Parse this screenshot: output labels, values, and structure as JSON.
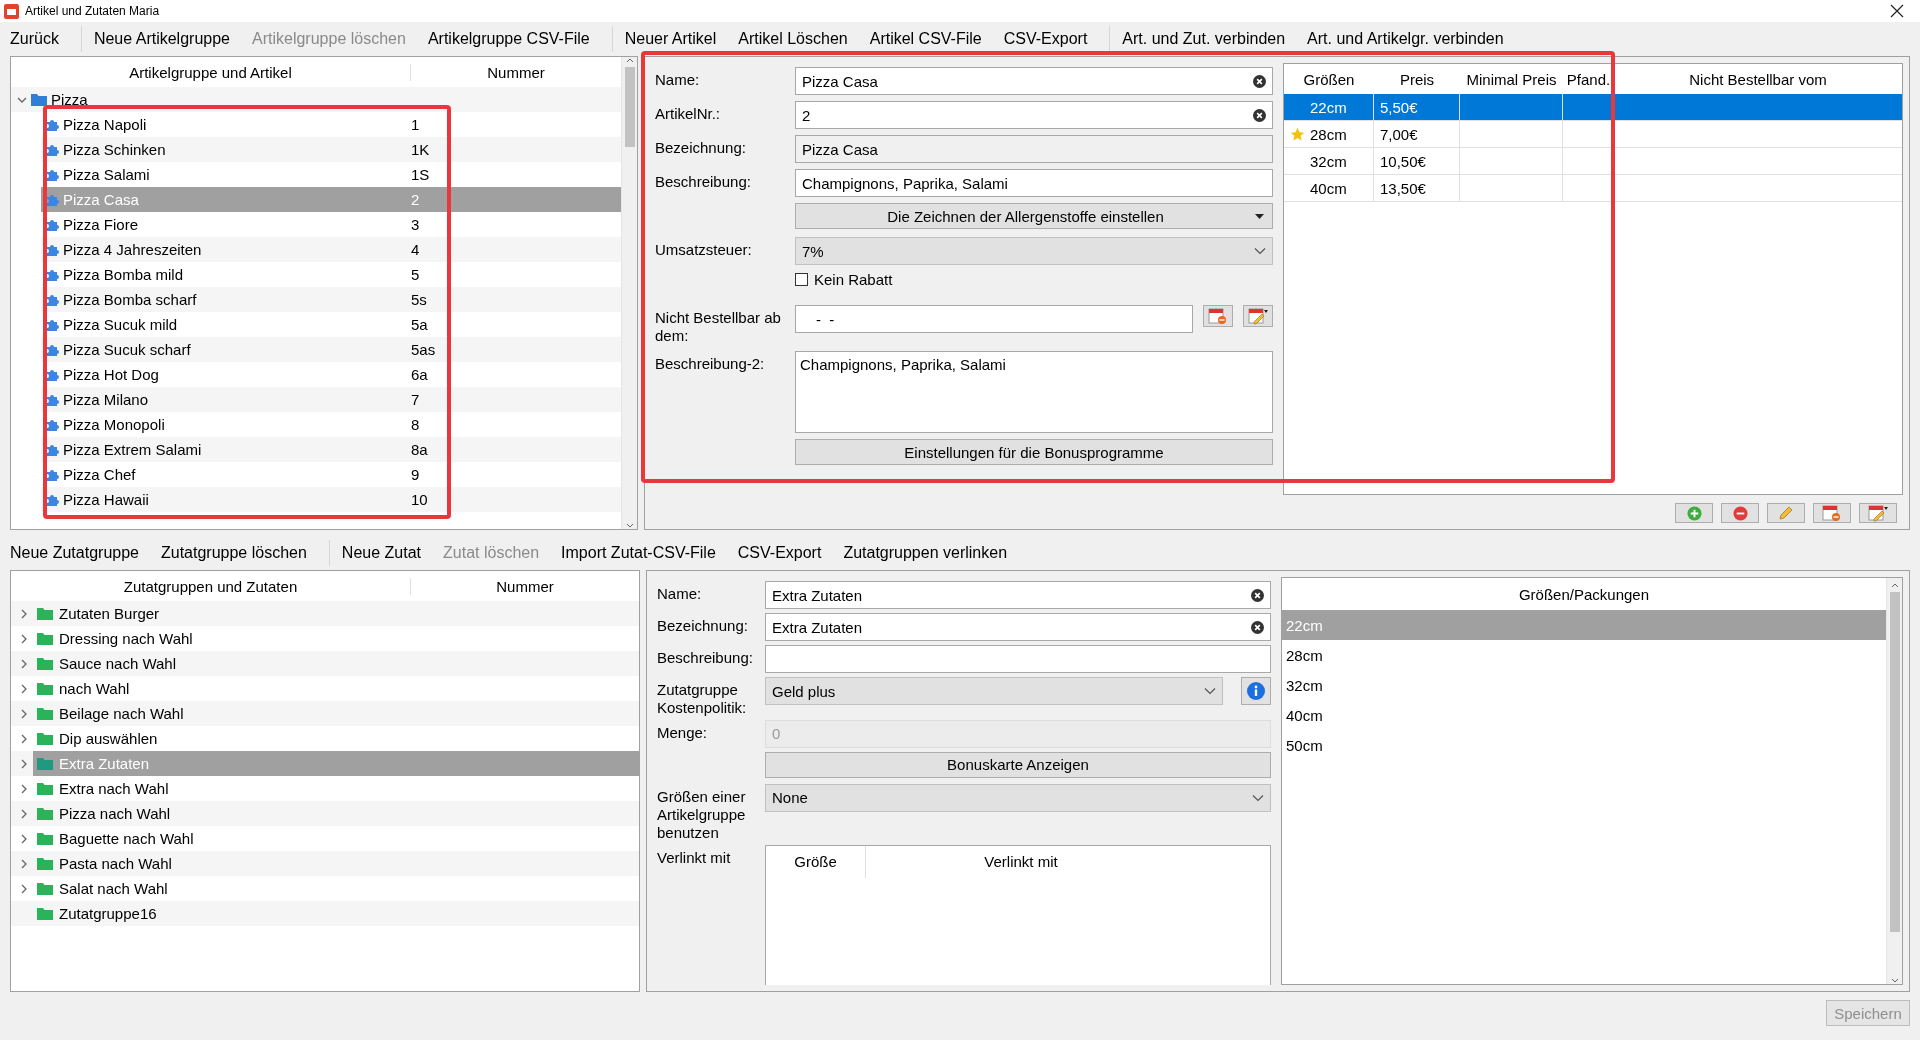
{
  "window": {
    "title": "Artikel und Zutaten Maria"
  },
  "toolbar": {
    "groups": [
      {
        "items": [
          {
            "label": "Zurück",
            "disabled": false
          }
        ]
      },
      {
        "items": [
          {
            "label": "Neue Artikelgruppe",
            "disabled": false
          },
          {
            "label": "Artikelgruppe löschen",
            "disabled": true
          },
          {
            "label": "Artikelgruppe CSV-File",
            "disabled": false
          }
        ]
      },
      {
        "items": [
          {
            "label": "Neuer Artikel",
            "disabled": false
          },
          {
            "label": "Artikel Löschen",
            "disabled": false
          },
          {
            "label": "Artikel CSV-File",
            "disabled": false
          },
          {
            "label": "CSV-Export",
            "disabled": false
          }
        ]
      },
      {
        "items": [
          {
            "label": "Art. und Zut. verbinden",
            "disabled": false
          },
          {
            "label": "Art. und Artikelgr. verbinden",
            "disabled": false
          }
        ]
      }
    ]
  },
  "article_tree": {
    "columns": [
      "Artikelgruppe und Artikel",
      "Nummer"
    ],
    "groups": [
      {
        "name": "Pizza",
        "expanded": true,
        "children": [
          {
            "name": "Pizza Napoli",
            "number": "1",
            "selected": false
          },
          {
            "name": "Pizza Schinken",
            "number": "1K",
            "selected": false
          },
          {
            "name": "Pizza Salami",
            "number": "1S",
            "selected": false
          },
          {
            "name": "Pizza Casa",
            "number": "2",
            "selected": true
          },
          {
            "name": "Pizza Fiore",
            "number": "3",
            "selected": false
          },
          {
            "name": "Pizza 4 Jahreszeiten",
            "number": "4",
            "selected": false
          },
          {
            "name": "Pizza Bomba mild",
            "number": "5",
            "selected": false
          },
          {
            "name": "Pizza Bomba scharf",
            "number": "5s",
            "selected": false
          },
          {
            "name": "Pizza Sucuk mild",
            "number": "5a",
            "selected": false
          },
          {
            "name": "Pizza Sucuk scharf",
            "number": "5as",
            "selected": false
          },
          {
            "name": "Pizza Hot Dog",
            "number": "6a",
            "selected": false
          },
          {
            "name": "Pizza Milano",
            "number": "7",
            "selected": false
          },
          {
            "name": "Pizza Monopoli",
            "number": "8",
            "selected": false
          },
          {
            "name": "Pizza Extrem Salami",
            "number": "8a",
            "selected": false
          },
          {
            "name": "Pizza Chef",
            "number": "9",
            "selected": false
          },
          {
            "name": "Pizza Hawaii",
            "number": "10",
            "selected": false
          }
        ]
      }
    ]
  },
  "article_form": {
    "rows": [
      {
        "kind": "clearable",
        "label": "Name:",
        "value": "Pizza Casa"
      },
      {
        "kind": "clearable",
        "label": "ArtikelNr.:",
        "value": "2"
      },
      {
        "kind": "readonly",
        "label": "Bezeichnung:",
        "value": "Pizza Casa"
      },
      {
        "kind": "text",
        "label": "Beschreibung:",
        "value": "Champignons, Paprika, Salami"
      },
      {
        "kind": "menu-button",
        "text": "Die Zeichnen der Allergenstoffe einstellen"
      },
      {
        "kind": "select",
        "label": "Umsatzsteuer:",
        "value": "7%"
      },
      {
        "kind": "checkbox",
        "text": "Kein Rabatt",
        "checked": false
      },
      {
        "kind": "date",
        "label": "Nicht Bestellbar ab dem:",
        "value": "-  -"
      },
      {
        "kind": "textarea",
        "label": "Beschreibung-2:",
        "value": "Champignons, Paprika, Salami"
      },
      {
        "kind": "button",
        "text": "Einstellungen für die Bonusprogramme"
      }
    ]
  },
  "sizes_table": {
    "columns": [
      "Größen",
      "Preis",
      "Minimal Preis",
      "Pfand.",
      "Nicht Bestellbar vom"
    ],
    "rows": [
      {
        "size": "22cm",
        "price": "5,50€",
        "selected": true,
        "starred": false
      },
      {
        "size": "28cm",
        "price": "7,00€",
        "selected": false,
        "starred": true
      },
      {
        "size": "32cm",
        "price": "10,50€",
        "selected": false,
        "starred": false
      },
      {
        "size": "40cm",
        "price": "13,50€",
        "selected": false,
        "starred": false
      }
    ]
  },
  "ingredient_toolbar": {
    "groups": [
      {
        "items": [
          {
            "label": "Neue Zutatgruppe",
            "disabled": false
          },
          {
            "label": "Zutatgruppe löschen",
            "disabled": false
          }
        ]
      },
      {
        "items": [
          {
            "label": "Neue Zutat",
            "disabled": false
          },
          {
            "label": "Zutat löschen",
            "disabled": true
          },
          {
            "label": "Import Zutat-CSV-File",
            "disabled": false
          },
          {
            "label": "CSV-Export",
            "disabled": false
          },
          {
            "label": "Zutatgruppen verlinken",
            "disabled": false
          }
        ]
      }
    ]
  },
  "ingredient_tree": {
    "columns": [
      "Zutatgruppen und Zutaten",
      "Nummer"
    ],
    "items": [
      {
        "name": "Zutaten Burger",
        "has_children": true,
        "selected": false
      },
      {
        "name": "Dressing nach Wahl",
        "has_children": true,
        "selected": false
      },
      {
        "name": "Sauce nach Wahl",
        "has_children": true,
        "selected": false
      },
      {
        "name": "nach Wahl",
        "has_children": true,
        "selected": false
      },
      {
        "name": "Beilage nach Wahl",
        "has_children": true,
        "selected": false
      },
      {
        "name": "Dip auswählen",
        "has_children": true,
        "selected": false
      },
      {
        "name": "Extra Zutaten",
        "has_children": true,
        "selected": true
      },
      {
        "name": "Extra nach Wahl",
        "has_children": true,
        "selected": false
      },
      {
        "name": "Pizza nach Wahl",
        "has_children": true,
        "selected": false
      },
      {
        "name": "Baguette nach Wahl",
        "has_children": true,
        "selected": false
      },
      {
        "name": "Pasta nach Wahl",
        "has_children": true,
        "selected": false
      },
      {
        "name": "Salat nach Wahl",
        "has_children": true,
        "selected": false
      },
      {
        "name": "Zutatgruppe16",
        "has_children": false,
        "selected": false
      }
    ]
  },
  "ingredient_form": {
    "rows": [
      {
        "kind": "clearable",
        "label": "Name:",
        "value": "Extra Zutaten"
      },
      {
        "kind": "clearable",
        "label": "Bezeichnung:",
        "value": "Extra Zutaten"
      },
      {
        "kind": "text",
        "label": "Beschreibung:"
      },
      {
        "kind": "info-select",
        "label": "Zutatgruppe Kostenpolitik:",
        "value": "Geld plus"
      },
      {
        "kind": "disabled-text",
        "label": "Menge:",
        "value": "0"
      },
      {
        "kind": "button",
        "text": "Bonuskarte Anzeigen"
      },
      {
        "kind": "select",
        "label": "Größen einer Artikelgruppe benutzen",
        "value": "None"
      },
      {
        "kind": "link-table",
        "label": "Verlinkt mit",
        "columns": [
          "Größe",
          "Verlinkt mit"
        ]
      }
    ]
  },
  "packages": {
    "header": "Größen/Packungen",
    "items": [
      {
        "label": "22cm",
        "selected": true
      },
      {
        "label": "28cm",
        "selected": false
      },
      {
        "label": "32cm",
        "selected": false
      },
      {
        "label": "40cm",
        "selected": false
      },
      {
        "label": "50cm",
        "selected": false
      }
    ]
  },
  "footer": {
    "save_button": {
      "label": "Speichern",
      "disabled": true
    }
  }
}
